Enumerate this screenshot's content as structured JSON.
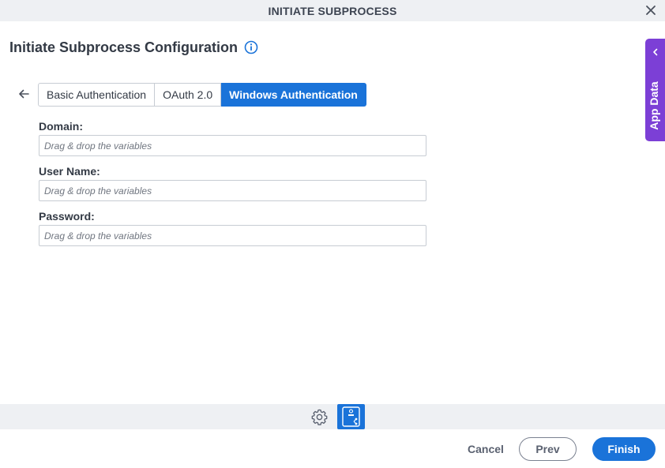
{
  "window": {
    "title": "INITIATE SUBPROCESS",
    "close_icon": "close-icon"
  },
  "header": {
    "title": "Initiate Subprocess Configuration",
    "info_icon": "info-icon"
  },
  "tabs": [
    {
      "label": "Basic Authentication",
      "active": false
    },
    {
      "label": "OAuth 2.0",
      "active": false
    },
    {
      "label": "Windows Authentication",
      "active": true
    }
  ],
  "form": {
    "domain": {
      "label": "Domain:",
      "value": "",
      "placeholder": "Drag & drop the variables"
    },
    "username": {
      "label": "User Name:",
      "value": "",
      "placeholder": "Drag & drop the variables"
    },
    "password": {
      "label": "Password:",
      "value": "",
      "placeholder": "Drag & drop the variables"
    }
  },
  "side_panel": {
    "label": "App Data",
    "icon": "chevron-left-icon"
  },
  "toolbar": {
    "settings_icon": "gear-icon",
    "diagram_icon": "process-diagram-icon"
  },
  "footer": {
    "cancel_label": "Cancel",
    "prev_label": "Prev",
    "finish_label": "Finish"
  },
  "colors": {
    "accent": "#1a73d9",
    "side_panel": "#7c3fd6",
    "title_bar": "#eef0f3"
  }
}
